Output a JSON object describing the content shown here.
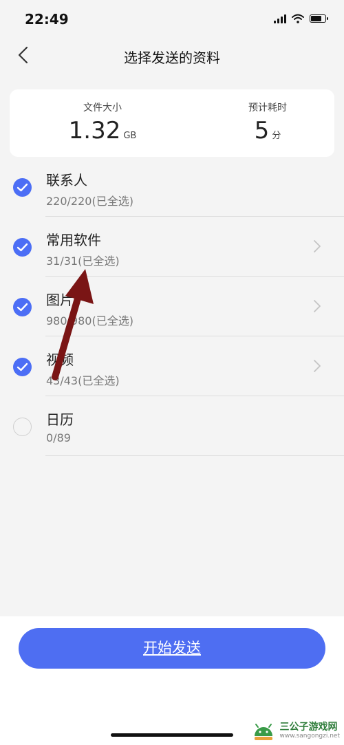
{
  "status": {
    "time": "22:49",
    "battery_level": 0.75
  },
  "header": {
    "title": "选择发送的资料"
  },
  "summary": {
    "size_label": "文件大小",
    "size_value": "1.32",
    "size_unit": "GB",
    "time_label": "预计耗时",
    "time_value": "5",
    "time_unit": "分"
  },
  "items": [
    {
      "title": "联系人",
      "subtitle": "220/220(已全选)",
      "checked": true,
      "chevron": false
    },
    {
      "title": "常用软件",
      "subtitle": "31/31(已全选)",
      "checked": true,
      "chevron": true
    },
    {
      "title": "图片",
      "subtitle": "980/980(已全选)",
      "checked": true,
      "chevron": true
    },
    {
      "title": "视频",
      "subtitle": "43/43(已全选)",
      "checked": true,
      "chevron": true
    },
    {
      "title": "日历",
      "subtitle": "0/89",
      "checked": false,
      "chevron": false
    }
  ],
  "actions": {
    "start_label": "开始发送"
  },
  "colors": {
    "accent": "#4e6ef2",
    "annotation_arrow": "#7a1515"
  },
  "watermark": {
    "title": "三公子游戏网",
    "url": "www.sangongzi.net"
  }
}
